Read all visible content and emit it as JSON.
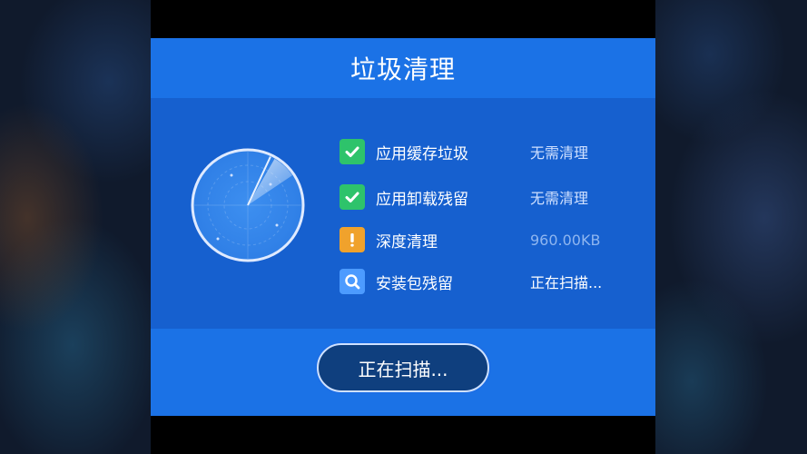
{
  "dialog": {
    "title": "垃圾清理"
  },
  "scan_items": [
    {
      "icon": "checkmark-icon",
      "label": "应用缓存垃圾",
      "status": "无需清理"
    },
    {
      "icon": "checkmark-icon",
      "label": "应用卸载残留",
      "status": "无需清理"
    },
    {
      "icon": "warning-icon",
      "label": "深度清理",
      "status": "960.00KB"
    },
    {
      "icon": "search-icon",
      "label": "安装包残留",
      "status": "正在扫描..."
    }
  ],
  "scan_button": {
    "label": "正在扫描..."
  },
  "colors": {
    "dialog_blue": "#1a6fe0",
    "check_green": "#2ec36b",
    "warn_orange": "#f0a22c",
    "button_dark": "#0f3f7e"
  }
}
